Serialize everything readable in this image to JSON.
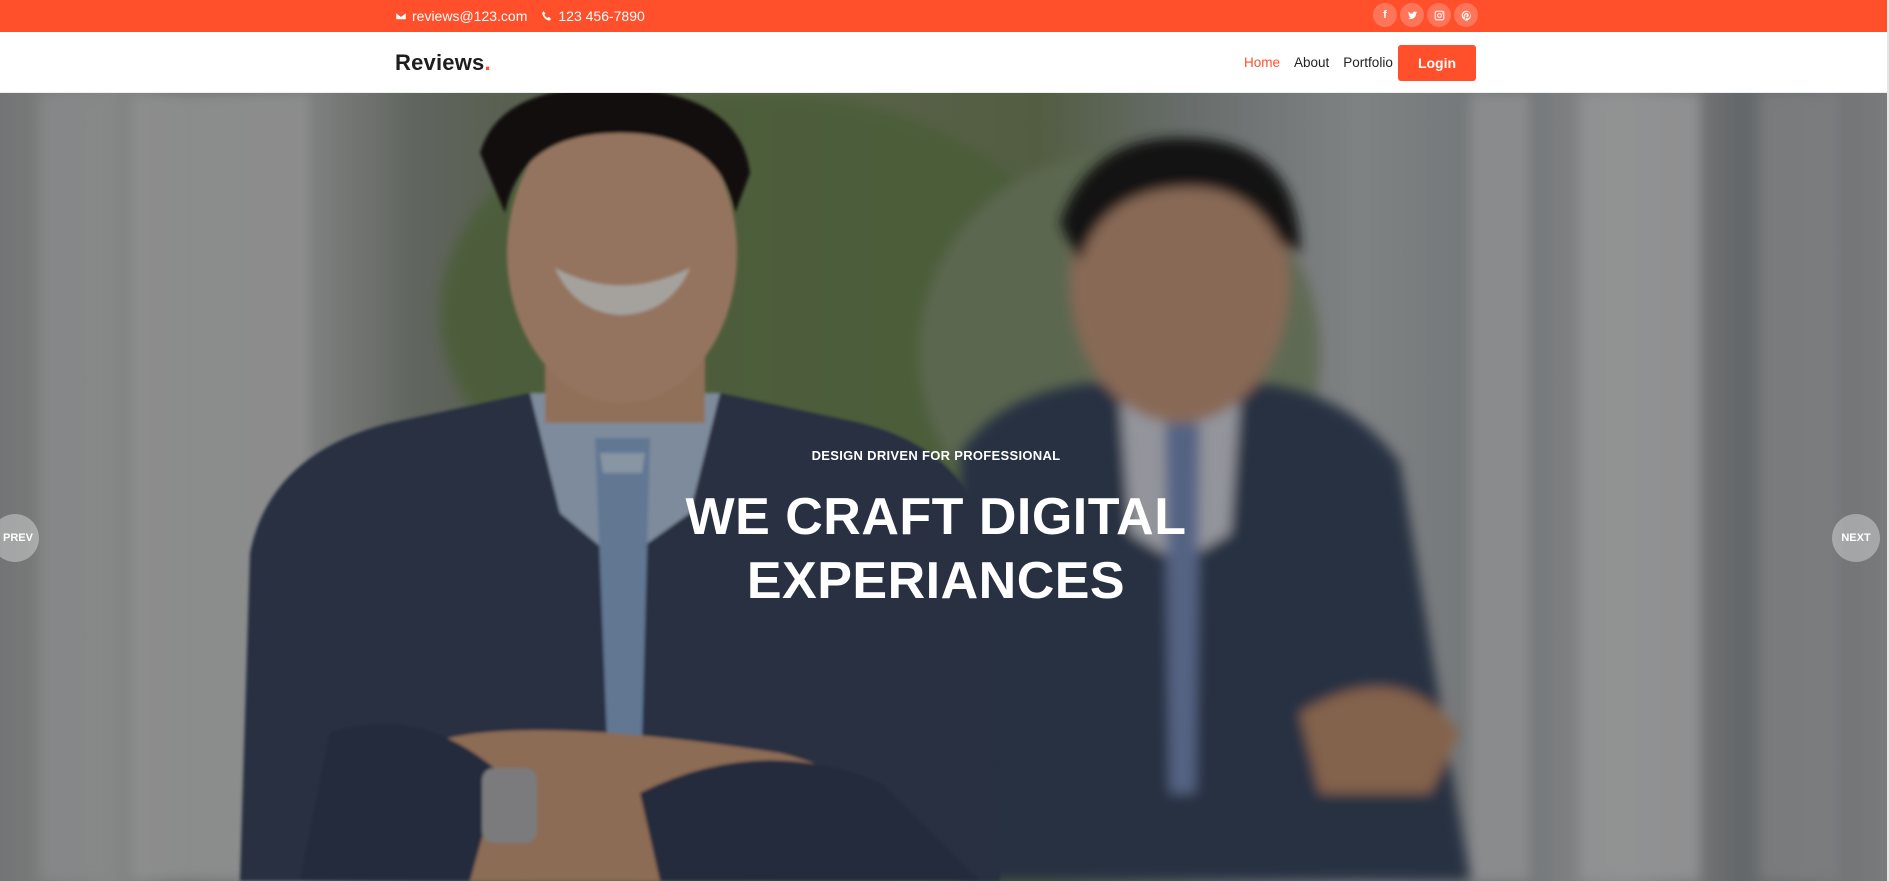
{
  "topbar": {
    "email": "reviews@123.com",
    "phone": "123 456-7890",
    "socials": [
      {
        "name": "facebook",
        "glyph": "f"
      },
      {
        "name": "twitter",
        "glyph": ""
      },
      {
        "name": "instagram",
        "glyph": ""
      },
      {
        "name": "pinterest",
        "glyph": ""
      }
    ],
    "color": "#ff4f2b"
  },
  "navbar": {
    "logo_text": "Reviews",
    "logo_dot": ".",
    "menu": [
      {
        "label": "Home",
        "active": true
      },
      {
        "label": "About",
        "active": false
      },
      {
        "label": "Portfolio",
        "active": false
      }
    ],
    "login_label": "Login"
  },
  "hero": {
    "eyebrow": "DESIGN DRIVEN FOR PROFESSIONAL",
    "headline_line1": "WE CRAFT DIGITAL",
    "headline_line2": "EXPERIANCES",
    "prev_label": "PREV",
    "next_label": "NEXT"
  }
}
